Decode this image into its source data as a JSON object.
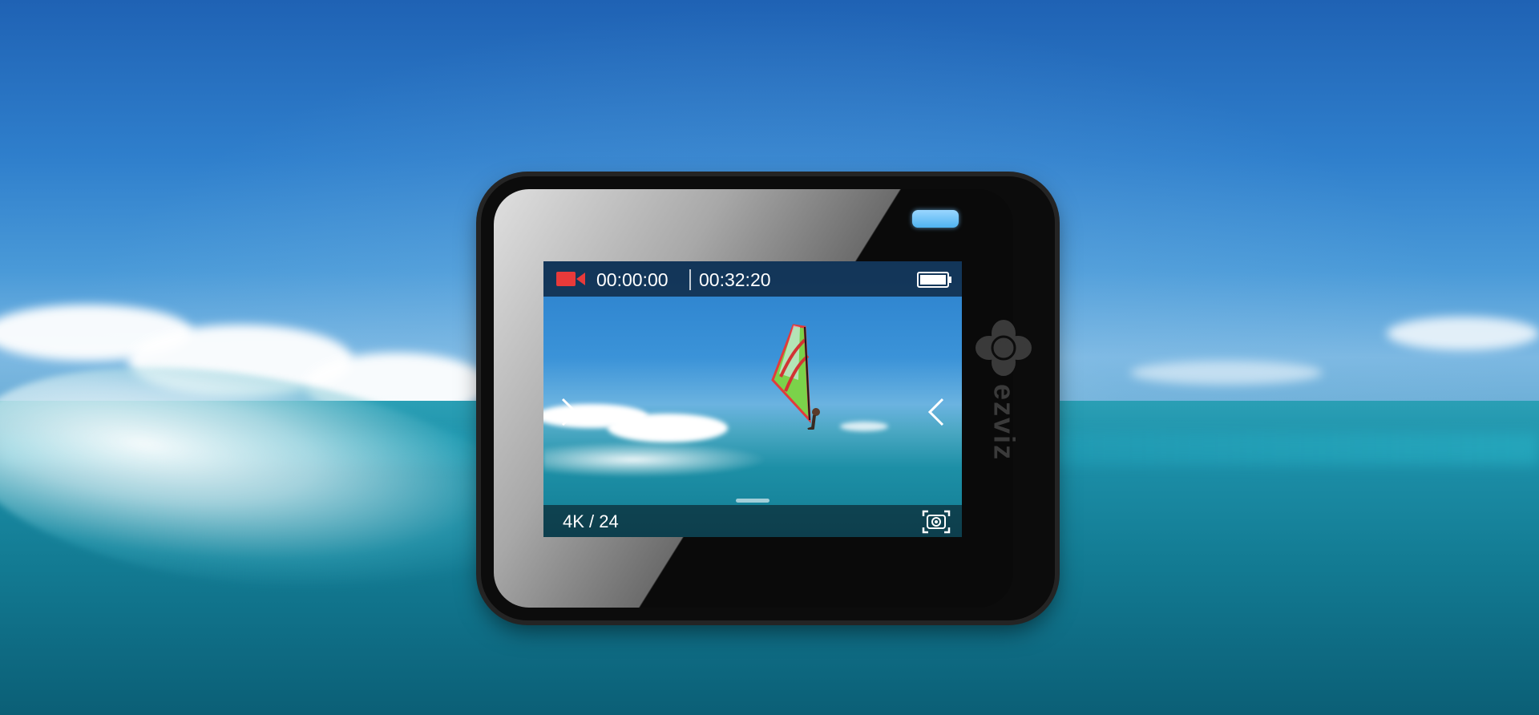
{
  "screen": {
    "recording_elapsed": "00:00:00",
    "recording_remaining": "00:32:20",
    "resolution_fps": "4K / 24",
    "battery_level": 1.0
  },
  "brand": {
    "name": "EZVIZ"
  },
  "icons": {
    "record": "record-video-icon",
    "battery": "battery-icon",
    "snapshot": "snapshot-icon",
    "left": "chevron-right-icon",
    "right": "chevron-left-icon"
  },
  "colors": {
    "record_red": "#e83a3a",
    "status_led": "#6cc4f6",
    "screen_bar": "#0a192d"
  }
}
